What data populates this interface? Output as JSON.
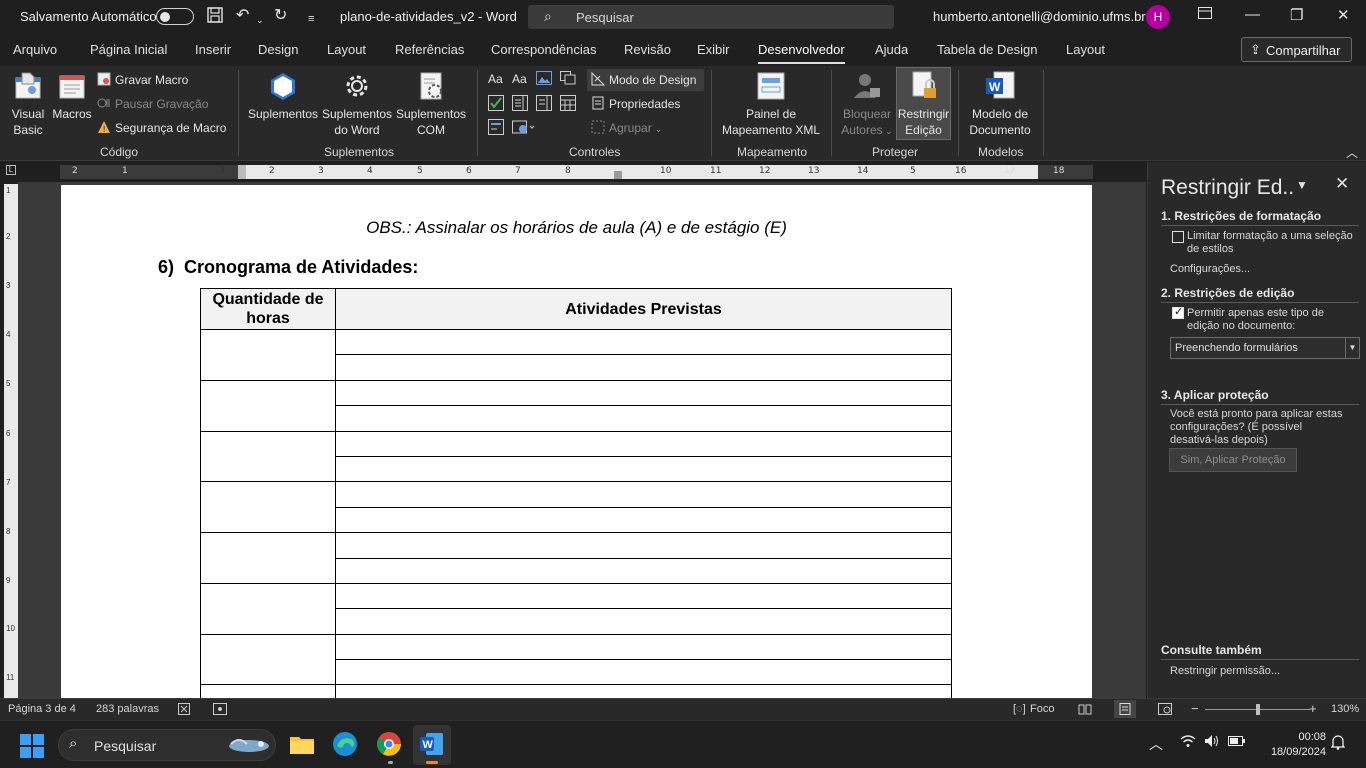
{
  "titlebar": {
    "autosave_label": "Salvamento Automático",
    "doc_title": "plano-de-atividades_v2  -  Word",
    "search_placeholder": "Pesquisar",
    "user": "humberto.antonelli@dominio.ufms.br",
    "avatar_initial": "H"
  },
  "menu": {
    "tabs": [
      "Arquivo",
      "Página Inicial",
      "Inserir",
      "Design",
      "Layout",
      "Referências",
      "Correspondências",
      "Revisão",
      "Exibir",
      "Desenvolvedor",
      "Ajuda",
      "Tabela de Design",
      "Layout"
    ],
    "active": "Desenvolvedor",
    "share_label": "Compartilhar"
  },
  "ribbon": {
    "codigo": {
      "group": "Código",
      "visual_basic": "Visual Basic",
      "visual_basic_l1": "Visual",
      "visual_basic_l2": "Basic",
      "macros": "Macros",
      "gravar_macro": "Gravar Macro",
      "pausar_gravacao": "Pausar Gravação",
      "seguranca_macro": "Segurança de Macro"
    },
    "suplementos": {
      "group": "Suplementos",
      "suplementos": "Suplementos",
      "suplementos_word_l1": "Suplementos",
      "suplementos_word_l2": "do Word",
      "suplementos_com_l1": "Suplementos",
      "suplementos_com_l2": "COM"
    },
    "controles": {
      "group": "Controles",
      "modo_design": "Modo de Design",
      "propriedades": "Propriedades",
      "agrupar": "Agrupar"
    },
    "mapeamento": {
      "group": "Mapeamento",
      "painel_l1": "Painel de",
      "painel_l2": "Mapeamento XML"
    },
    "proteger": {
      "group": "Proteger",
      "bloquear_l1": "Bloquear",
      "bloquear_l2": "Autores",
      "restringir_l1": "Restringir",
      "restringir_l2": "Edição"
    },
    "modelos": {
      "group": "Modelos",
      "modelo_l1": "Modelo de",
      "modelo_l2": "Documento"
    }
  },
  "ruler": {
    "labels": [
      "2",
      "1",
      "1",
      "2",
      "3",
      "4",
      "5",
      "6",
      "7",
      "8",
      "10",
      "11",
      "12",
      "13",
      "14",
      "5",
      "16",
      "17",
      "18"
    ],
    "vlabels": [
      "1",
      "2",
      "3",
      "4",
      "5",
      "6",
      "7",
      "8",
      "9",
      "10",
      "11"
    ]
  },
  "document": {
    "obs": "OBS.: Assinalar os horários de aula (A) e de estágio (E)",
    "heading_num": "6)",
    "heading_text": "Cronograma de Atividades:",
    "table": {
      "col1_header_l1": "Quantidade de",
      "col1_header_l2": "horas",
      "col2_header": "Atividades Previstas",
      "row_groups": 8
    }
  },
  "pane": {
    "title": "Restringir Ed..",
    "sec1_title": "1. Restrições de formatação",
    "sec1_check_l1": "Limitar formatação a uma seleção",
    "sec1_check_l2": "de estilos",
    "sec1_check_checked": false,
    "sec1_link": "Configurações...",
    "sec2_title": "2. Restrições de edição",
    "sec2_check_l1": "Permitir apenas este tipo de",
    "sec2_check_l2": "edição no documento:",
    "sec2_check_checked": true,
    "sec2_select": "Preenchendo formulários",
    "sec3_title": "3. Aplicar proteção",
    "sec3_text_l1": "Você está pronto para aplicar estas",
    "sec3_text_l2": "configurações? (É possível",
    "sec3_text_l3": "desativá-las depois)",
    "sec3_button": "Sim, Aplicar Proteção",
    "see_also_title": "Consulte também",
    "see_also_link": "Restringir permissão..."
  },
  "statusbar": {
    "page": "Página 3 de 4",
    "words": "283 palavras",
    "focus": "Foco",
    "zoom": "130%"
  },
  "taskbar": {
    "search": "Pesquisar",
    "time": "00:08",
    "date": "18/09/2024"
  },
  "colors": {
    "word_blue": "#185abd",
    "avatar": "#b4009e",
    "dark_bg": "#1f1f1f",
    "ribbon_bg": "#292929"
  }
}
